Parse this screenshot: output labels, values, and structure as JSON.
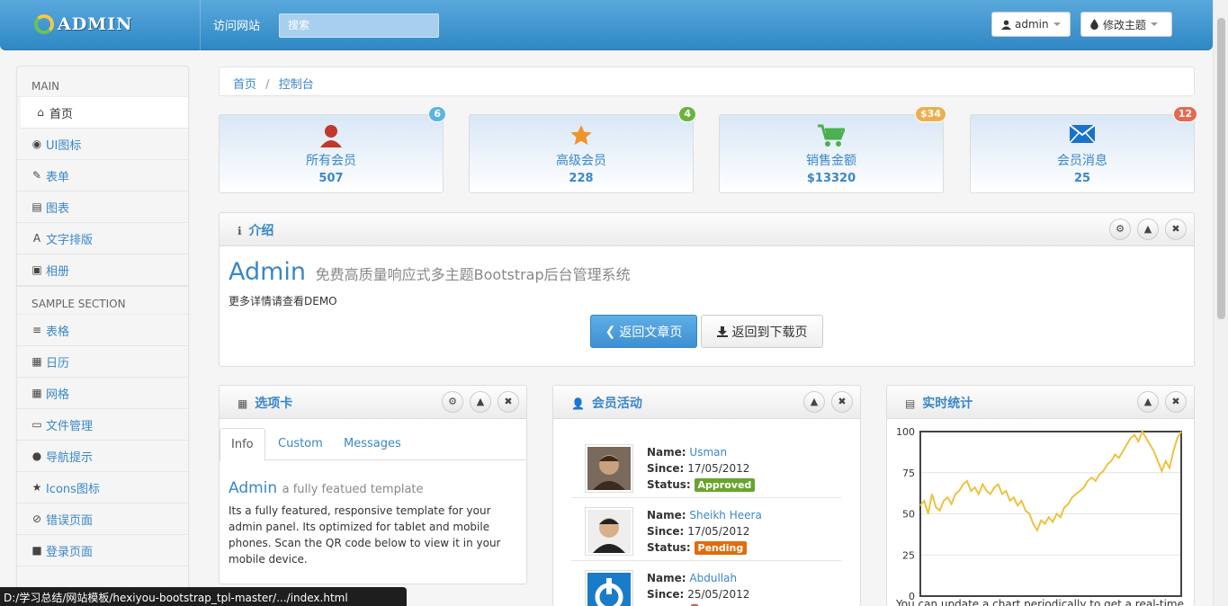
{
  "navbar": {
    "brand": "ADMIN",
    "visit_site": "访问网站",
    "search_placeholder": "搜索",
    "user_button": "admin",
    "theme_button": "修改主题"
  },
  "sidebar": {
    "section_main": "MAIN",
    "main_items": [
      {
        "label": "首页",
        "icon": "home-icon",
        "active": true
      },
      {
        "label": "UI图标",
        "icon": "eye-icon"
      },
      {
        "label": "表单",
        "icon": "edit-icon"
      },
      {
        "label": "图表",
        "icon": "list-alt-icon"
      },
      {
        "label": "文字排版",
        "icon": "font-icon"
      },
      {
        "label": "相册",
        "icon": "picture-icon"
      }
    ],
    "section_sample": "SAMPLE SECTION",
    "sample_items": [
      {
        "label": "表格",
        "icon": "align-justify-icon"
      },
      {
        "label": "日历",
        "icon": "calendar-icon"
      },
      {
        "label": "网格",
        "icon": "th-icon"
      },
      {
        "label": "文件管理",
        "icon": "folder-open-icon"
      },
      {
        "label": "导航提示",
        "icon": "globe-icon"
      },
      {
        "label": "Icons图标",
        "icon": "star-icon"
      },
      {
        "label": "错误页面",
        "icon": "ban-icon"
      },
      {
        "label": "登录页面",
        "icon": "lock-icon"
      }
    ]
  },
  "breadcrumb": {
    "home": "首页",
    "separator": "/",
    "current": "控制台"
  },
  "stats": [
    {
      "label": "所有会员",
      "value": "507",
      "badge": "6",
      "badge_color": "#5bb4e5",
      "icon": "user-icon",
      "icon_color": "#c0392b"
    },
    {
      "label": "高级会员",
      "value": "228",
      "badge": "4",
      "badge_color": "#6cb33e",
      "icon": "star-icon",
      "icon_color": "#f0932b"
    },
    {
      "label": "销售金额",
      "value": "$13320",
      "badge": "$34",
      "badge_color": "#f0ad4e",
      "icon": "cart-icon",
      "icon_color": "#4caf50"
    },
    {
      "label": "会员消息",
      "value": "25",
      "badge": "12",
      "badge_color": "#e8674f",
      "icon": "envelope-icon",
      "icon_color": "#1a73c8"
    }
  ],
  "intro": {
    "title": "介绍",
    "heading": "Admin",
    "subheading": "免费高质量响应式多主题Bootstrap后台管理系统",
    "text": "更多详情请查看DEMO",
    "btn_back_article": "返回文章页",
    "btn_back_download": "返回到下载页"
  },
  "tabs_box": {
    "title": "选项卡",
    "tabs": [
      "Info",
      "Custom",
      "Messages"
    ],
    "content_title": "Admin",
    "content_subtitle": "a fully featued template",
    "content_text": "Its a fully featured, responsive template for your admin panel. Its optimized for tablet and mobile phones. Scan the QR code below to view it in your mobile device."
  },
  "members_box": {
    "title": "会员活动",
    "name_label": "Name:",
    "since_label": "Since:",
    "status_label": "Status:",
    "members": [
      {
        "name": "Usman",
        "since": "17/05/2012",
        "status": "Approved",
        "status_color": "#6aa42f"
      },
      {
        "name": "Sheikh Heera",
        "since": "17/05/2012",
        "status": "Pending",
        "status_color": "#e06c0c"
      },
      {
        "name": "Abdullah",
        "since": "25/05/2012",
        "status": "",
        "status_color": "#d9534f"
      }
    ]
  },
  "stats_box": {
    "title": "实时统计",
    "footer_text": "You can update a chart periodically to get a real-time"
  },
  "chart_data": {
    "type": "line",
    "ylim": [
      0,
      100
    ],
    "yticks": [
      "100",
      "75",
      "50",
      "25",
      "0"
    ],
    "line_color": "#edc240",
    "values": [
      55,
      58,
      50,
      62,
      54,
      52,
      58,
      60,
      56,
      62,
      64,
      68,
      70,
      64,
      66,
      62,
      68,
      64,
      62,
      66,
      68,
      62,
      64,
      58,
      60,
      55,
      58,
      52,
      50,
      44,
      40,
      46,
      44,
      48,
      45,
      50,
      48,
      54,
      56,
      60,
      62,
      64,
      66,
      70,
      72,
      70,
      74,
      76,
      80,
      82,
      86,
      84,
      88,
      92,
      96,
      98,
      94,
      100,
      96,
      92,
      88,
      82,
      76,
      82,
      78,
      88,
      96,
      100
    ]
  },
  "statusbar": {
    "text": "D:/学习总结/网站模板/hexiyou-bootstrap_tpl-master/.../index.html"
  }
}
